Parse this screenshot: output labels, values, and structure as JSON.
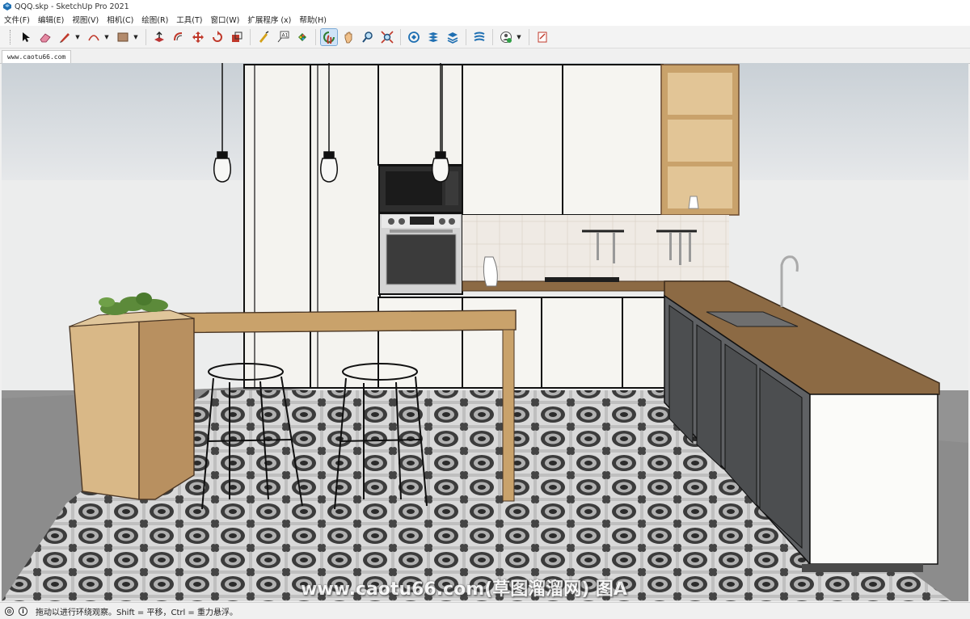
{
  "window": {
    "title": "QQQ.skp - SketchUp Pro 2021"
  },
  "menu": [
    "文件(F)",
    "编辑(E)",
    "视图(V)",
    "相机(C)",
    "绘图(R)",
    "工具(T)",
    "窗口(W)",
    "扩展程序 (x)",
    "帮助(H)"
  ],
  "toolbar": {
    "tools": [
      {
        "name": "select-tool",
        "icon": "arrow-icon"
      },
      {
        "name": "eraser-tool",
        "icon": "eraser-icon"
      },
      {
        "name": "line-tool",
        "icon": "pencil-icon"
      },
      {
        "name": "arc-tool",
        "icon": "arc-icon"
      },
      {
        "name": "shapes-tool",
        "icon": "rectangle-icon"
      },
      {
        "name": "push-pull-tool",
        "icon": "push-pull-icon"
      },
      {
        "name": "offset-tool",
        "icon": "offset-icon"
      },
      {
        "name": "move-tool",
        "icon": "move-icon"
      },
      {
        "name": "rotate-tool",
        "icon": "rotate-icon"
      },
      {
        "name": "scale-tool",
        "icon": "scale-icon"
      },
      {
        "name": "tape-measure-tool",
        "icon": "tape-measure-icon"
      },
      {
        "name": "text-tool",
        "icon": "text-icon"
      },
      {
        "name": "paint-bucket-tool",
        "icon": "paint-bucket-icon"
      },
      {
        "name": "orbit-tool",
        "icon": "orbit-icon",
        "active": true
      },
      {
        "name": "pan-tool",
        "icon": "hand-icon"
      },
      {
        "name": "zoom-tool",
        "icon": "magnifier-icon"
      },
      {
        "name": "zoom-extents-tool",
        "icon": "zoom-extents-icon"
      },
      {
        "name": "3d-warehouse-tool",
        "icon": "warehouse-icon"
      },
      {
        "name": "extension-warehouse-tool",
        "icon": "extension-warehouse-icon"
      },
      {
        "name": "layout-tool",
        "icon": "layout-icon"
      },
      {
        "name": "extension-manager-tool",
        "icon": "extension-manager-icon"
      },
      {
        "name": "profile-tool",
        "icon": "user-profile-icon"
      },
      {
        "name": "sandbox-tool",
        "icon": "notebook-icon"
      }
    ]
  },
  "scene_tab": {
    "label": "www.caotu66.com"
  },
  "watermark": {
    "text": "www.caotu66.com(草图溜溜网) 图A"
  },
  "statusbar": {
    "text": "拖动以进行环绕观察。Shift = 平移，Ctrl = 重力悬浮。",
    "icon1": "geo-location-icon",
    "icon2": "info-icon"
  },
  "colors": {
    "wood": "#c9a26b",
    "countertop": "#8c6a44",
    "cabinet_white": "#f7f5f0",
    "cabinet_grey": "#5f6164",
    "sky": "#cdd3d8",
    "floor_grey": "#8a8a8a",
    "active_tool": "#cfe3f7"
  }
}
